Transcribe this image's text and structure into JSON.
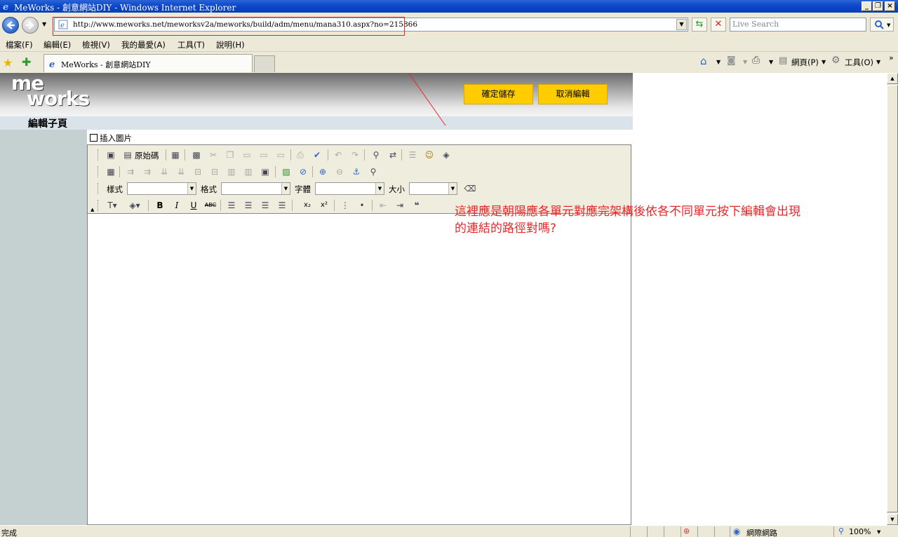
{
  "window": {
    "title": "MeWorks - 創意網站DIY - Windows Internet Explorer",
    "minimize_glyph": "_",
    "restore_glyph": "❐",
    "close_glyph": "×"
  },
  "address": {
    "url": "http://www.meworks.net/meworksv2a/meworks/build/adm/menu/mana310.aspx?no=215866"
  },
  "search": {
    "placeholder": "Live Search"
  },
  "menu": [
    "檔案(F)",
    "編輯(E)",
    "檢視(V)",
    "我的最愛(A)",
    "工具(T)",
    "說明(H)"
  ],
  "tab": {
    "title": "MeWorks - 創意網站DIY"
  },
  "commandbar": {
    "page_label": "網頁(P)",
    "tools_label": "工具(O)"
  },
  "site": {
    "logo_line1": "me",
    "logo_line2": "works",
    "save_label": "確定儲存",
    "cancel_label": "取消編輯",
    "section_title": "編輯子頁",
    "insert_image_label": "插入圖片"
  },
  "editor": {
    "source_label": "原始碼",
    "style_label": "樣式",
    "format_label": "格式",
    "font_label": "字體",
    "size_label": "大小"
  },
  "annotation": {
    "line1": "這裡應是朝陽應各單元對應完架構後依各不同單元按下編輯會出現",
    "line2": "的連結的路徑對嗎?",
    "color": "#e8262a"
  },
  "status": {
    "text": "完成",
    "zone": "網際網路",
    "zoom": "100%"
  },
  "colors": {
    "button_yellow": "#ffcc00",
    "left_column": "#c5d0d0",
    "titlebar_blue": "#0a46c8"
  }
}
